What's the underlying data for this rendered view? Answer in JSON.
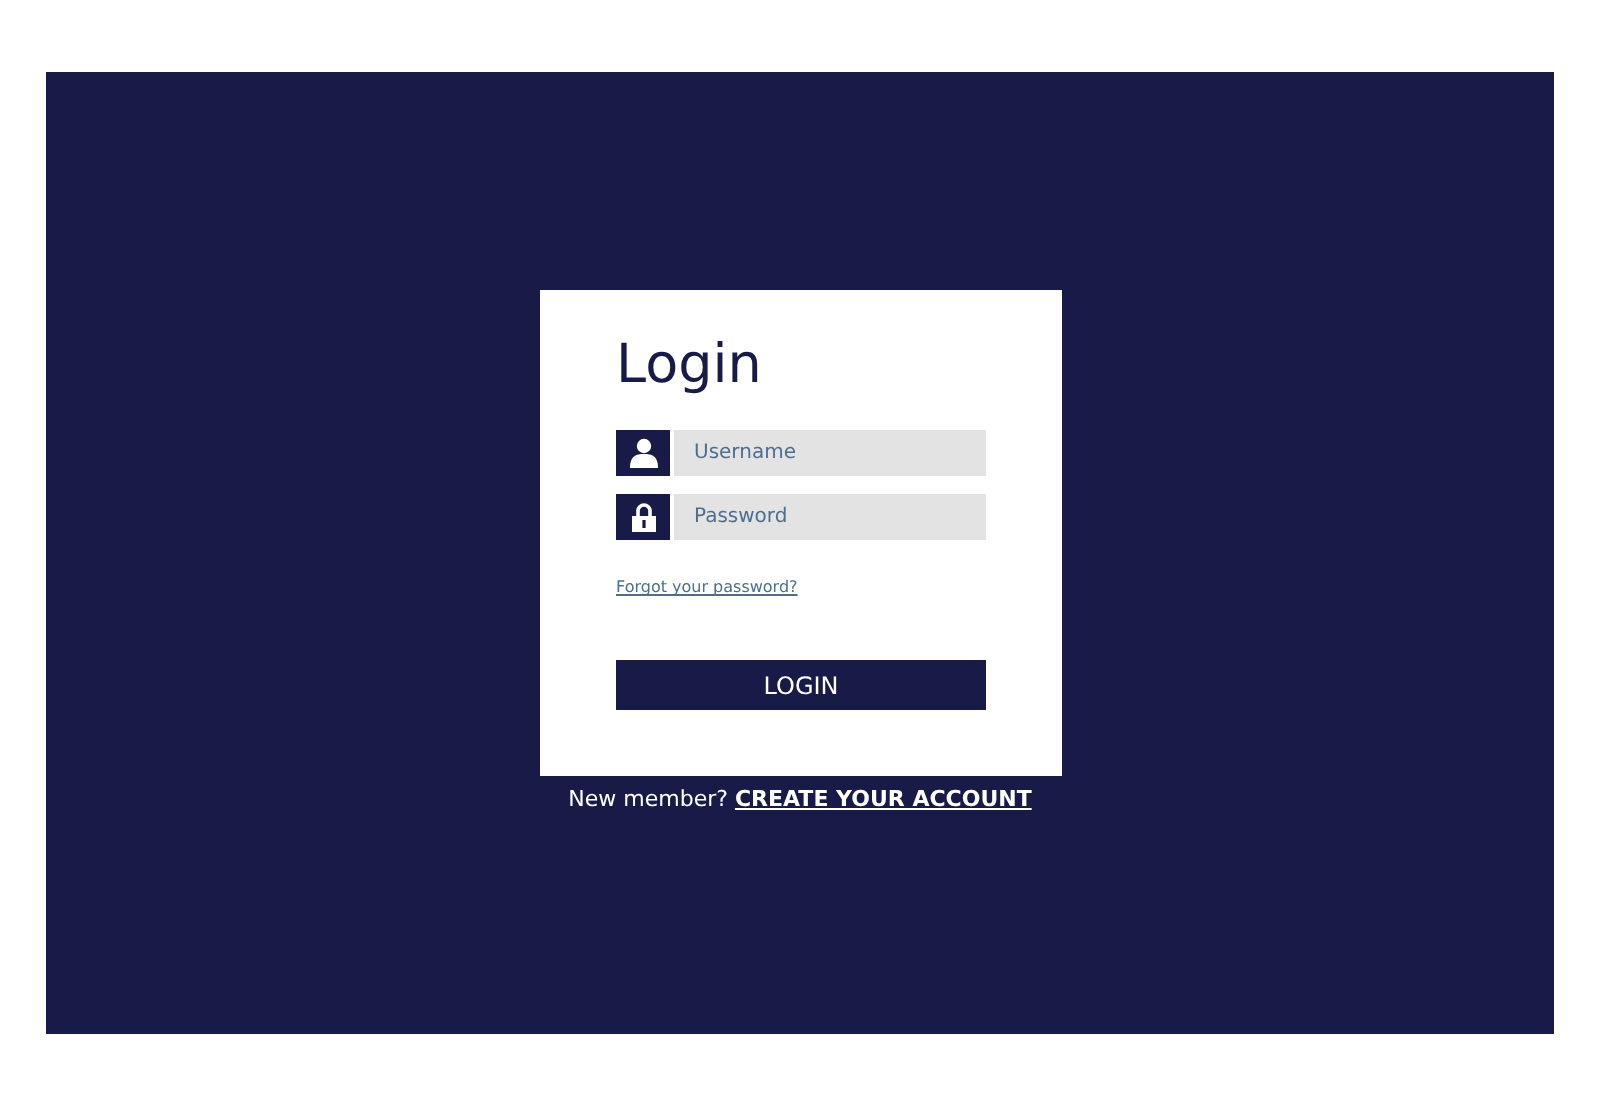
{
  "title": "Login",
  "fields": [
    {
      "kind": "user",
      "placeholder": "Username"
    },
    {
      "kind": "lock",
      "placeholder": "Password"
    }
  ],
  "forgot_link": "Forgot your password?",
  "login_button": "LOGIN",
  "footer": {
    "text": "New member?",
    "link": "CREATE YOUR ACCOUNT"
  }
}
